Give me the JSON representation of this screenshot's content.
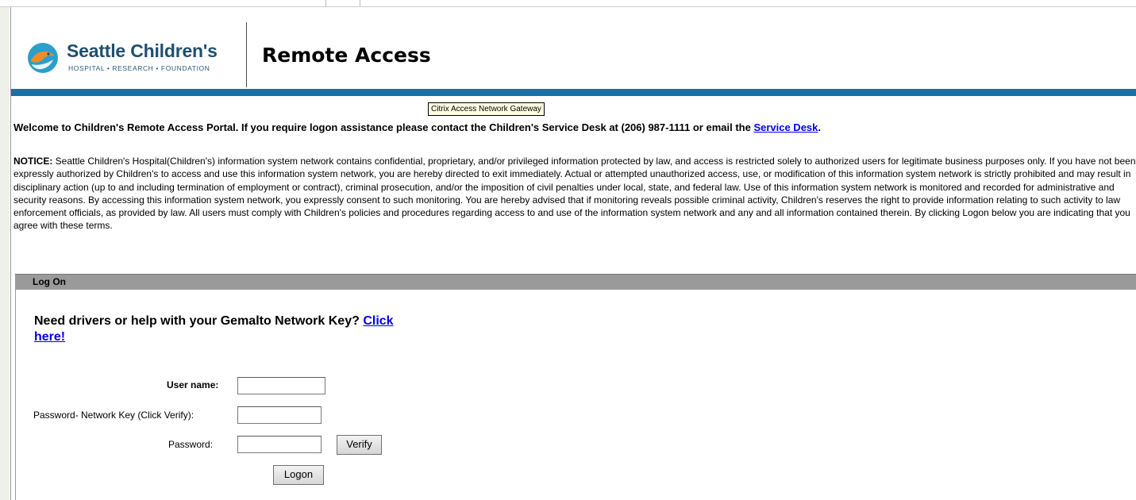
{
  "header": {
    "logo_name": "Seattle Children's",
    "logo_tagline": "HOSPITAL • RESEARCH • FOUNDATION",
    "title": "Remote Access"
  },
  "tooltip": {
    "text": "Citrix Access Network Gateway"
  },
  "welcome": {
    "text": "Welcome to Children's Remote Access Portal. If you require logon assistance please contact the Children's Service Desk at (206) 987-1111 or email the ",
    "link_text": "Service Desk",
    "suffix": "."
  },
  "notice": {
    "label": "NOTICE:",
    "text": " Seattle Children's Hospital(Children's) information system network contains confidential, proprietary, and/or privileged information protected by law, and access is restricted solely to authorized users for legitimate business purposes only. If you have not been expressly authorized by Children's to access and use this information system network, you are hereby directed to exit immediately. Actual or attempted unauthorized access, use, or modification of this information system network is strictly prohibited and may result in disciplinary action (up to and including termination of employment or contract), criminal prosecution, and/or the imposition of civil penalties under local, state, and federal law. Use of this information system network is monitored and recorded for administrative and security reasons. By accessing this information system network, you expressly consent to such monitoring. You are hereby advised that if monitoring reveals possible criminal activity, Children's reserves the right to provide information relating to such activity to law enforcement officials, as provided by law. All users must comply with Children's policies and procedures regarding access to and use of the information system network and any and all information contained therein. By clicking Logon below you are indicating that you agree with these terms."
  },
  "logon": {
    "bar_label": "Log On",
    "help_text": "Need drivers or help with your Gemalto Network Key? ",
    "help_link": "Click here!",
    "username_label": "User name:",
    "username_value": "",
    "network_key_label": "Password- Network Key (Click Verify):",
    "network_key_value": "",
    "password_label": "Password:",
    "password_value": "",
    "verify_button": "Verify",
    "logon_button": "Logon"
  },
  "colors": {
    "brand_blue": "#1d6ea3",
    "logo_orange": "#f08a2e",
    "logo_teal": "#2a9fc9",
    "bar_gray": "#9a9a9a"
  }
}
